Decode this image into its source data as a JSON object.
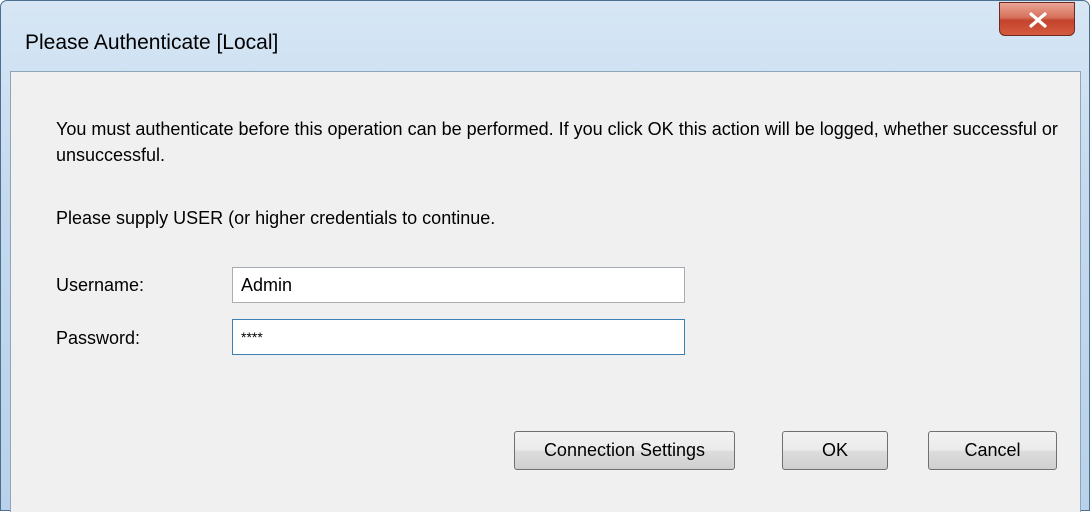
{
  "window": {
    "title": "Please Authenticate [Local]"
  },
  "dialog": {
    "message": "You must authenticate before this operation can be performed. If you click OK this action will be logged, whether successful or unsuccessful.",
    "prompt": "Please supply USER (or higher credentials to continue."
  },
  "form": {
    "username_label": "Username:",
    "username_value": "Admin",
    "password_label": "Password:",
    "password_value": "****"
  },
  "buttons": {
    "connection_settings": "Connection Settings",
    "ok": "OK",
    "cancel": "Cancel"
  },
  "icons": {
    "close": "close-icon"
  },
  "colors": {
    "close_button": "#c4432c",
    "title_bar": "#c4d9ee",
    "dialog_background": "#f0f0f0",
    "focus_border": "#3c7fb1"
  }
}
